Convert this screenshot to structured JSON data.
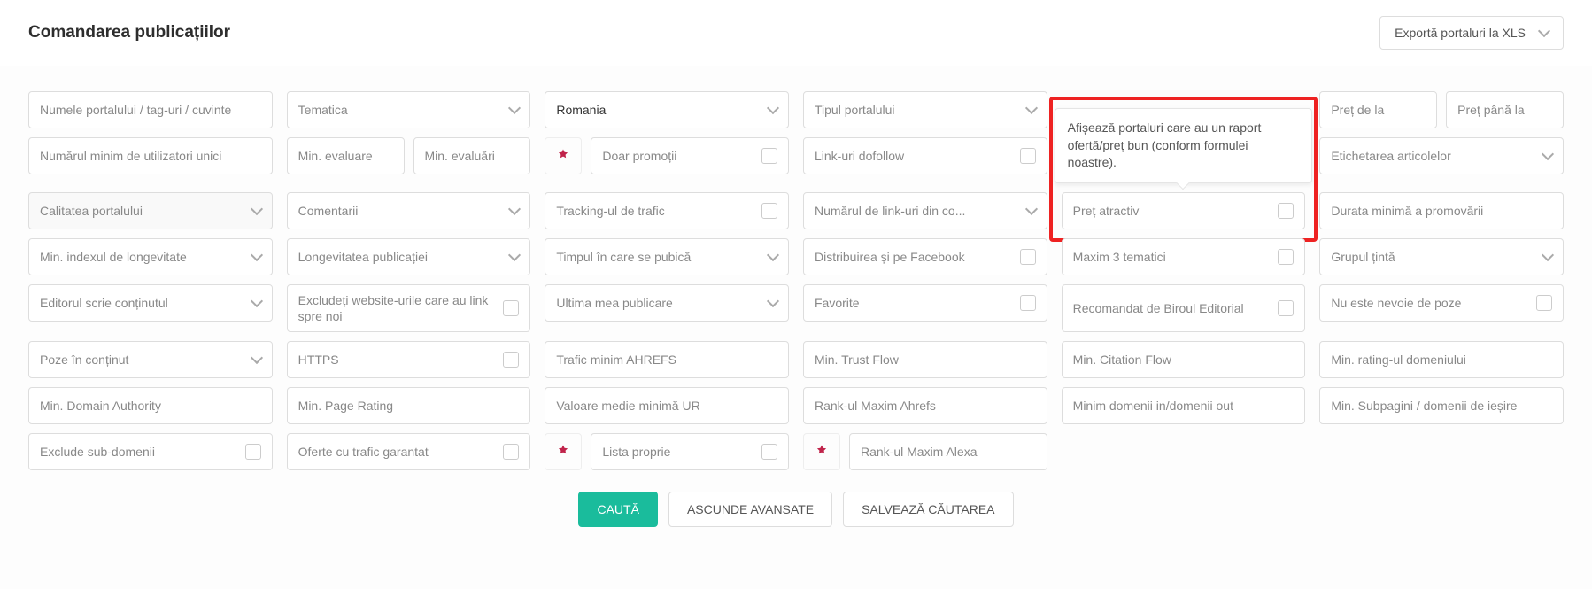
{
  "header": {
    "title": "Comandarea publicațiilor",
    "export_label": "Exportă portaluri la XLS"
  },
  "tooltip": {
    "text": "Afișează portaluri care au un raport ofertă/preț bun (conform formulei noastre)."
  },
  "row1": {
    "portal_name": "Numele portalului / tag-uri / cuvinte",
    "theme": "Tematica",
    "country_value": "Romania",
    "portal_type": "Tipul portalului",
    "price_from": "Preț de la",
    "price_to": "Preț până la"
  },
  "row2": {
    "min_users": "Numărul minim de utilizatori unici",
    "min_eval_from": "Min. evaluare",
    "min_eval_to": "Min. evaluări",
    "only_promo": "Doar promoții",
    "dofollow": "Link-uri dofollow",
    "article_label": "Etichetarea articolelor"
  },
  "row3": {
    "quality": "Calitatea portalului",
    "comments": "Comentarii",
    "traffic_tracking": "Tracking-ul de trafic",
    "num_links": "Numărul de link-uri din co...",
    "attractive_price": "Preț atractiv",
    "promo_duration": "Durata minimă a promovării"
  },
  "row4": {
    "longevity_index": "Min. indexul de longevitate",
    "pub_longevity": "Longevitatea publicației",
    "publish_time": "Timpul în care se pubică",
    "fb_dist": "Distribuirea și pe Facebook",
    "max3themes": "Maxim 3 tematici",
    "target_group": "Grupul țintă"
  },
  "row5": {
    "editor_writes": "Editorul scrie conținutul",
    "exclude_linkback": "Excludeți website-urile care au link spre noi",
    "last_publish": "Ultima mea publicare",
    "favorite": "Favorite",
    "recommended": "Recomandat de Biroul Editorial",
    "no_photos": "Nu este nevoie de poze"
  },
  "row6": {
    "photos_in": "Poze în conținut",
    "https": "HTTPS",
    "ahrefs_min_traffic": "Trafic minim AHREFS",
    "min_trust_flow": "Min. Trust Flow",
    "min_citation_flow": "Min. Citation Flow",
    "min_domain_rating": "Min. rating-ul domeniului"
  },
  "row7": {
    "min_da": "Min. Domain Authority",
    "min_pr": "Min. Page Rating",
    "avg_ur": "Valoare medie minimă UR",
    "max_ahrefs_rank": "Rank-ul Maxim Ahrefs",
    "min_domains": "Minim domenii in/domenii out",
    "min_subpages": "Min. Subpagini / domenii de ieșire"
  },
  "row8": {
    "exclude_sub": "Exclude sub-domenii",
    "guaranteed_traffic": "Oferte cu trafic garantat",
    "own_list": "Lista proprie",
    "max_alexa": "Rank-ul Maxim Alexa"
  },
  "actions": {
    "search": "CAUTĂ",
    "hide_advanced": "ASCUNDE AVANSATE",
    "save_search": "SALVEAZĂ CĂUTAREA"
  }
}
